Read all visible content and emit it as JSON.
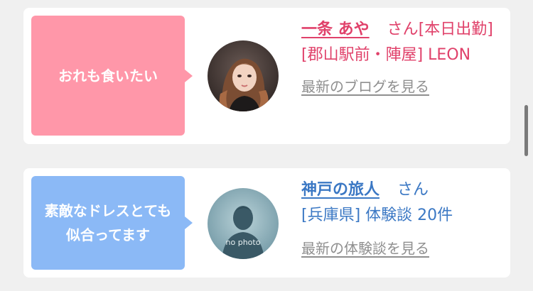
{
  "cards": [
    {
      "bubble_text": "おれも食いたい",
      "bubble_color": "#ff97a9",
      "avatar_icon": "photo-woman-avatar-icon",
      "name": "一条 あや",
      "honorific": "さん",
      "status": "[本日出勤]",
      "location": "[郡山駅前・陣屋] LEON",
      "link": "最新のブログを見る"
    },
    {
      "bubble_text": "素敵なドレスとても似合ってます",
      "bubble_color": "#8bb9f6",
      "avatar_icon": "no-photo-avatar-icon",
      "avatar_caption": "no photo",
      "name": "神戸の旅人",
      "honorific": "さん",
      "location": "[兵庫県] 体験談 20件",
      "link": "最新の体験談を見る"
    }
  ]
}
